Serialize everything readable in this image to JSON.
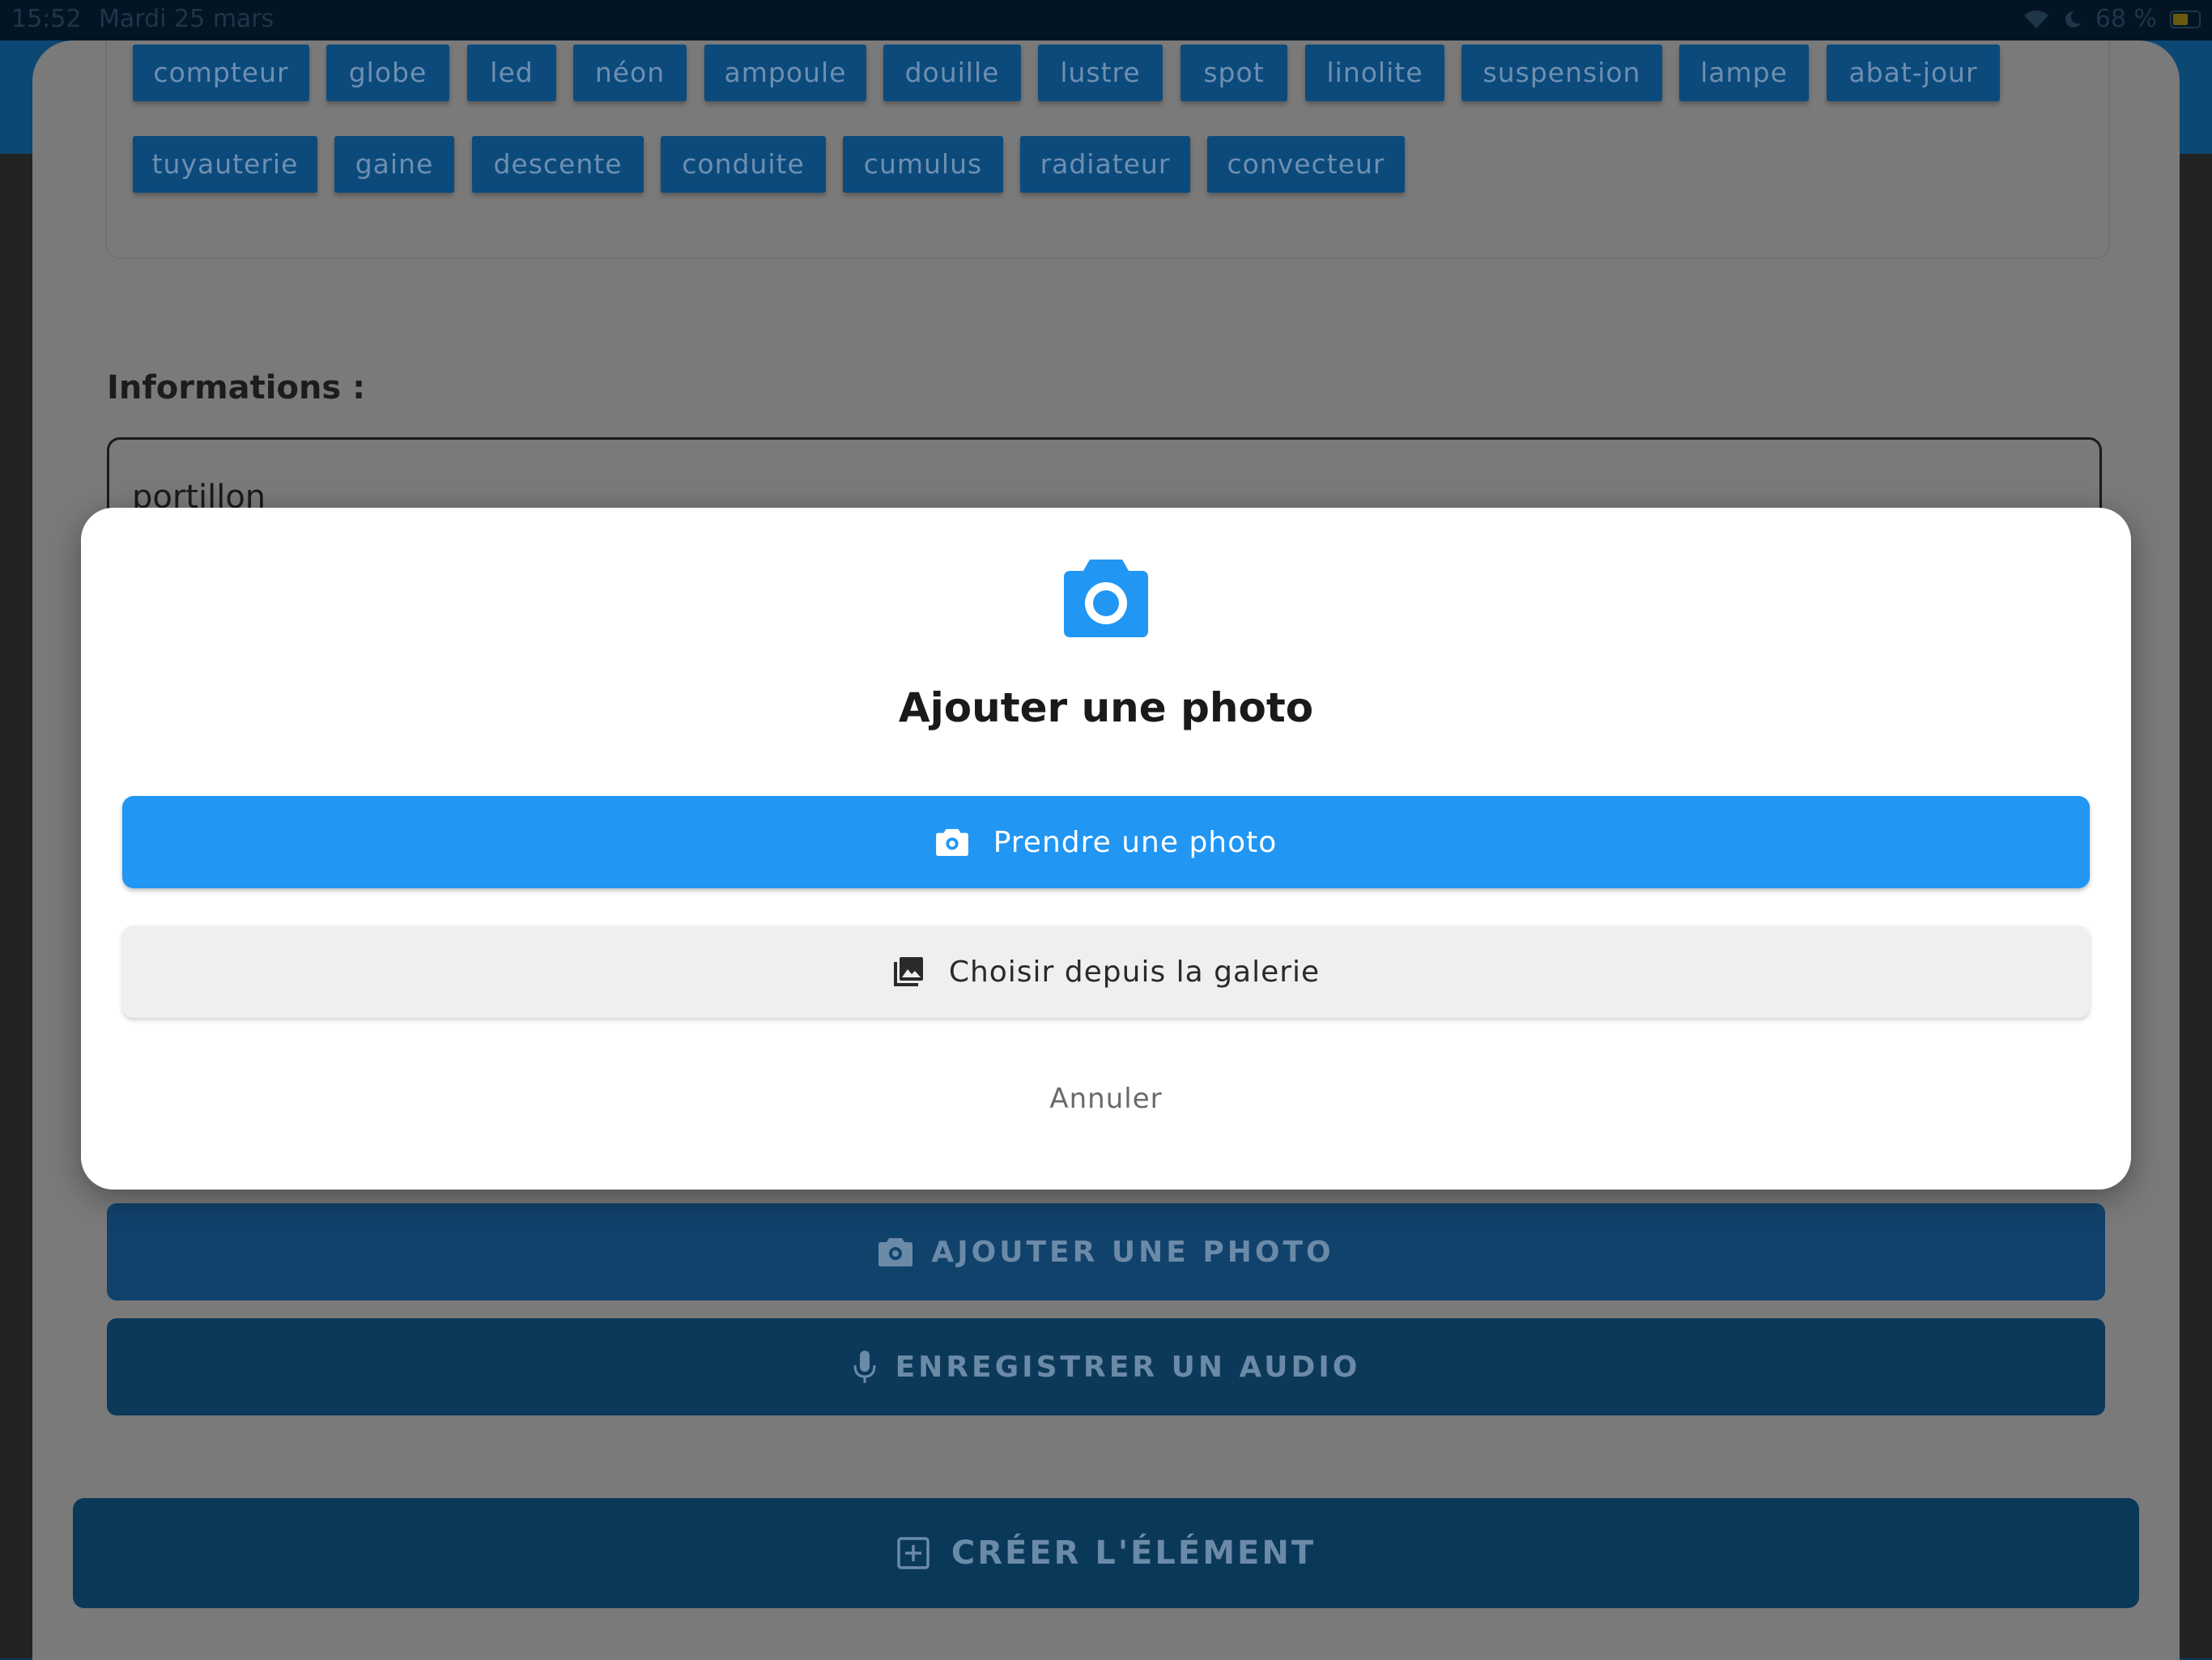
{
  "status_bar": {
    "time": "15:52",
    "date": "Mardi 25 mars",
    "battery": "68 %"
  },
  "tags": {
    "row1": [
      "compteur",
      "globe",
      "led",
      "néon",
      "ampoule",
      "douille",
      "lustre",
      "spot",
      "linolite",
      "suspension",
      "lampe",
      "abat-jour"
    ],
    "row2": [
      "tuyauterie",
      "gaine",
      "descente",
      "conduite",
      "cumulus",
      "radiateur",
      "convecteur"
    ]
  },
  "form": {
    "info_label": "Informations :",
    "info_value": "portillon",
    "add_photo_label": "AJOUTER UNE PHOTO",
    "record_audio_label": "ENREGISTRER UN AUDIO",
    "create_label": "CRÉER L'ÉLÉMENT"
  },
  "dialog": {
    "title": "Ajouter une photo",
    "take_photo_label": "Prendre une photo",
    "gallery_label": "Choisir depuis la galerie",
    "cancel_label": "Annuler"
  },
  "colors": {
    "primary": "#2196f3",
    "dark_blue": "#0c3859",
    "scrim": "#7a7a7a"
  }
}
